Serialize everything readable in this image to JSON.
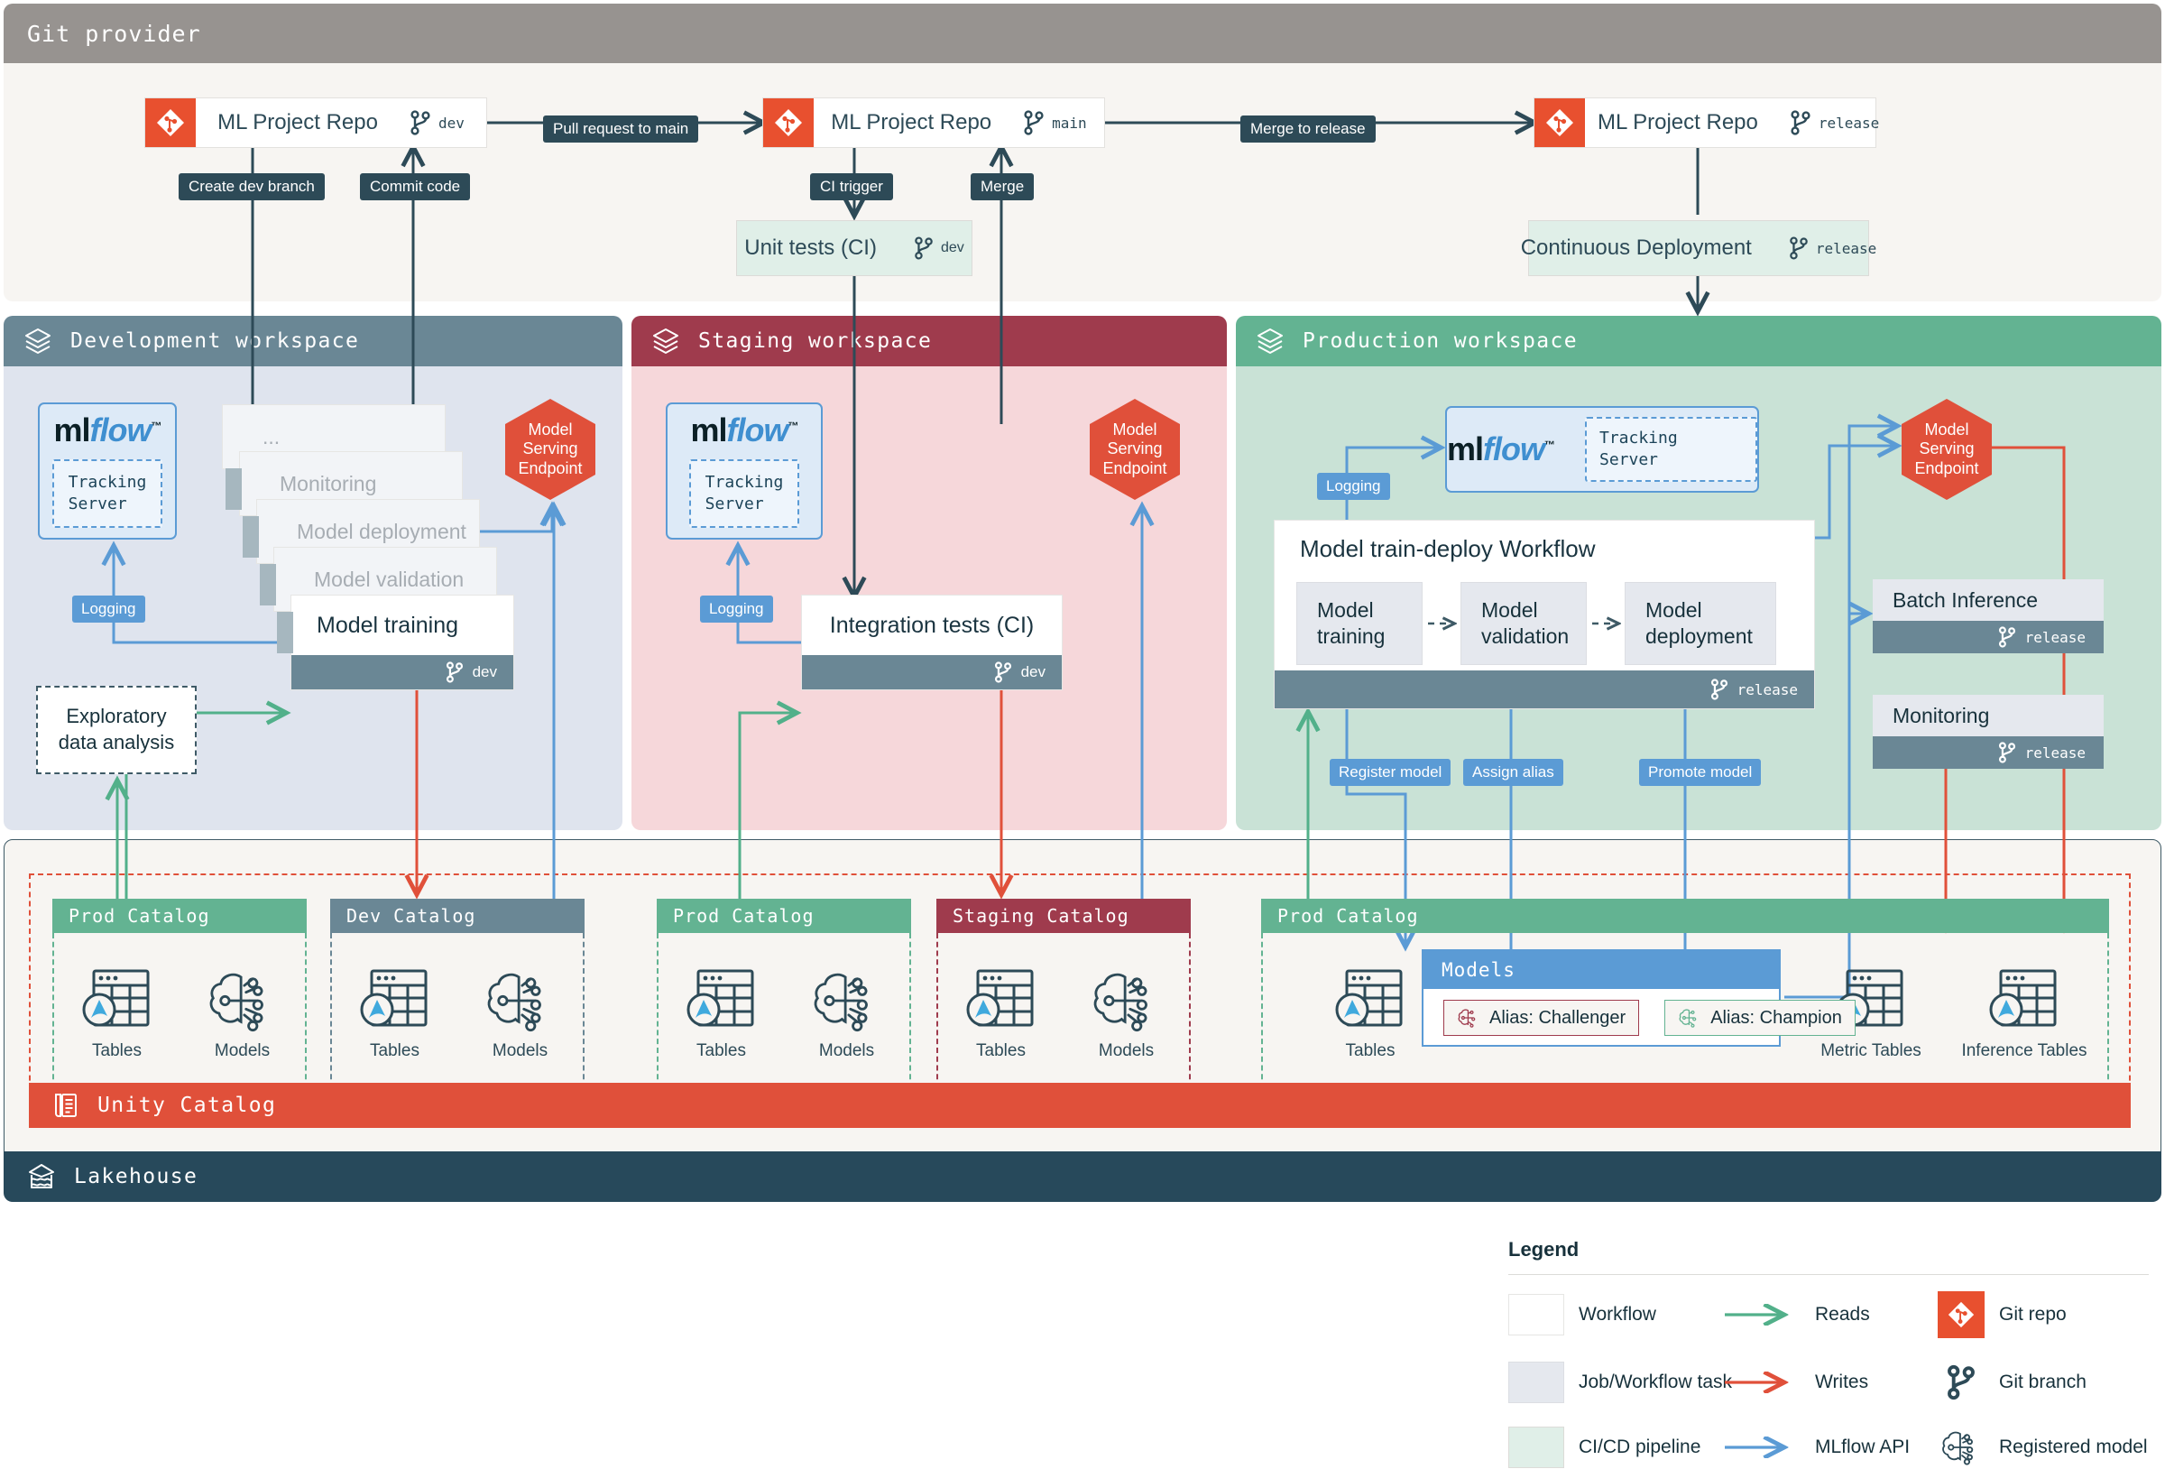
{
  "git_provider": {
    "title": "Git provider",
    "repos": [
      {
        "name": "ML Project Repo",
        "branch": "dev"
      },
      {
        "name": "ML Project Repo",
        "branch": "main"
      },
      {
        "name": "ML Project Repo",
        "branch": "release"
      }
    ],
    "edge_labels": {
      "create_dev_branch": "Create dev branch",
      "commit_code": "Commit code",
      "pull_request": "Pull request to main",
      "ci_trigger": "CI trigger",
      "merge": "Merge",
      "merge_to_release": "Merge to release"
    },
    "unit_tests": {
      "name": "Unit tests (CI)",
      "branch": "dev"
    },
    "continuous_deployment": {
      "name": "Continuous Deployment",
      "branch": "release"
    }
  },
  "workspaces": {
    "dev": {
      "title": "Development workspace",
      "mlflow": {
        "logo_a": "ml",
        "logo_b": "flow",
        "tracking_server": "Tracking\nServer"
      },
      "logging_label": "Logging",
      "serving_endpoint": "Model\nServing\nEndpoint",
      "stack": [
        "...",
        "Monitoring",
        "Model deployment",
        "Model validation"
      ],
      "active_task": {
        "name": "Model training",
        "branch": "dev"
      },
      "eda": "Exploratory\ndata analysis"
    },
    "staging": {
      "title": "Staging workspace",
      "mlflow": {
        "logo_a": "ml",
        "logo_b": "flow",
        "tracking_server": "Tracking\nServer"
      },
      "logging_label": "Logging",
      "serving_endpoint": "Model\nServing\nEndpoint",
      "integration_tests": {
        "name": "Integration tests (CI)",
        "branch": "dev"
      }
    },
    "production": {
      "title": "Production workspace",
      "mlflow": {
        "logo_a": "ml",
        "logo_b": "flow",
        "tracking_server": "Tracking Server"
      },
      "logging_label": "Logging",
      "serving_endpoint": "Model\nServing\nEndpoint",
      "workflow": {
        "title": "Model train-deploy Workflow",
        "branch": "release",
        "steps": [
          "Model\ntraining",
          "Model\nvalidation",
          "Model\ndeployment"
        ]
      },
      "api_labels": {
        "register_model": "Register model",
        "assign_alias": "Assign alias",
        "promote_model": "Promote model"
      },
      "jobs": [
        {
          "name": "Batch Inference",
          "branch": "release"
        },
        {
          "name": "Monitoring",
          "branch": "release"
        }
      ]
    }
  },
  "unity_catalog": {
    "bar_label": "Unity Catalog",
    "lakehouse_label": "Lakehouse",
    "catalogs": [
      {
        "name": "Prod Catalog",
        "theme": "prod",
        "assets": [
          "Tables",
          "Models"
        ]
      },
      {
        "name": "Dev Catalog",
        "theme": "dev",
        "assets": [
          "Tables",
          "Models"
        ]
      },
      {
        "name": "Prod Catalog",
        "theme": "prod",
        "assets": [
          "Tables",
          "Models"
        ]
      },
      {
        "name": "Staging Catalog",
        "theme": "staging",
        "assets": [
          "Tables",
          "Models"
        ]
      },
      {
        "name": "Prod Catalog",
        "theme": "prod",
        "assets": [
          "Tables",
          "Metric Tables",
          "Inference Tables"
        ]
      }
    ],
    "models_box": {
      "title": "Models",
      "aliases": [
        "Alias: Challenger",
        "Alias: Champion"
      ]
    }
  },
  "legend": {
    "title": "Legend",
    "items": [
      "Workflow",
      "Reads",
      "Git repo",
      "Job/Workflow task",
      "Writes",
      "Git branch",
      "CI/CD pipeline",
      "MLflow API",
      "Registered model"
    ]
  },
  "colors": {
    "reads": "#52b08a",
    "writes": "#e0503a",
    "mlflow_api": "#5b9bd5",
    "git": "#2d4a57",
    "unity_catalog": "#e0503a",
    "lakehouse": "#27495b",
    "dev_header": "#6a8795",
    "staging_header": "#9f3b4d",
    "production_header": "#63b392"
  }
}
